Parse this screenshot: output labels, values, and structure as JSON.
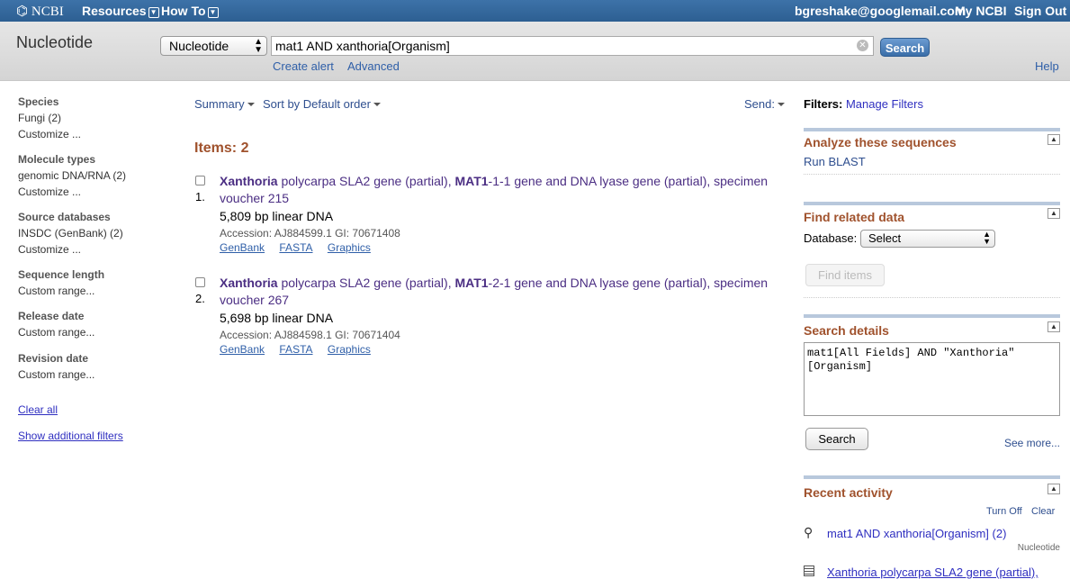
{
  "topbar": {
    "logo": "NCBI",
    "resources": "Resources",
    "howto": "How To",
    "user": "bgreshake@googlemail.com",
    "myncbi": "My NCBI",
    "signout": "Sign Out"
  },
  "searchbar": {
    "db_title": "Nucleotide",
    "db_select": "Nucleotide",
    "term": "mat1 AND xanthoria[Organism]",
    "search_button": "Search",
    "create_alert": "Create alert",
    "advanced": "Advanced",
    "help": "Help"
  },
  "filters": {
    "groups": [
      {
        "heading": "Species",
        "items": [
          "Fungi (2)",
          "Customize ..."
        ]
      },
      {
        "heading": "Molecule types",
        "items": [
          "genomic DNA/RNA (2)",
          "Customize ..."
        ]
      },
      {
        "heading": "Source databases",
        "items": [
          "INSDC (GenBank) (2)",
          "Customize ..."
        ]
      },
      {
        "heading": "Sequence length",
        "items": [
          "Custom range..."
        ]
      },
      {
        "heading": "Release date",
        "items": [
          "Custom range..."
        ]
      },
      {
        "heading": "Revision date",
        "items": [
          "Custom range..."
        ]
      }
    ],
    "clear_all": "Clear all",
    "show_additional": "Show additional filters"
  },
  "results": {
    "summary": "Summary",
    "sort": "Sort by Default order",
    "send": "Send:",
    "items_count": "Items: 2",
    "list": [
      {
        "number": "1.",
        "title_b1": "Xanthoria",
        "title_t1": " polycarpa SLA2 gene (partial), ",
        "title_b2": "MAT1",
        "title_t2": "-1-1 gene and DNA lyase gene (partial), specimen voucher 215",
        "desc": "5,809 bp linear DNA",
        "accession": "Accession: AJ884599.1   GI: 70671408",
        "links": [
          "GenBank",
          "FASTA",
          "Graphics"
        ]
      },
      {
        "number": "2.",
        "title_b1": "Xanthoria",
        "title_t1": " polycarpa SLA2 gene (partial), ",
        "title_b2": "MAT1",
        "title_t2": "-2-1 gene and DNA lyase gene (partial), specimen voucher 267",
        "desc": "5,698 bp linear DNA",
        "accession": "Accession: AJ884598.1   GI: 70671404",
        "links": [
          "GenBank",
          "FASTA",
          "Graphics"
        ]
      }
    ]
  },
  "sidebar": {
    "filters_label": "Filters:",
    "manage_filters": "Manage Filters",
    "analyze_heading": "Analyze these sequences",
    "run_blast": "Run BLAST",
    "find_related_heading": "Find related data",
    "database_label": "Database:",
    "database_select": "Select",
    "find_items": "Find items",
    "search_details_heading": "Search details",
    "search_details_text": "mat1[All Fields] AND \"Xanthoria\"\n[Organism]",
    "search_button": "Search",
    "see_more": "See more...",
    "recent_heading": "Recent activity",
    "turn_off": "Turn Off",
    "clear": "Clear",
    "recent_query": "mat1 AND xanthoria[Organism] (2)",
    "recent_db": "Nucleotide",
    "recent_item": "Xanthoria polycarpa SLA2 gene (partial),"
  }
}
